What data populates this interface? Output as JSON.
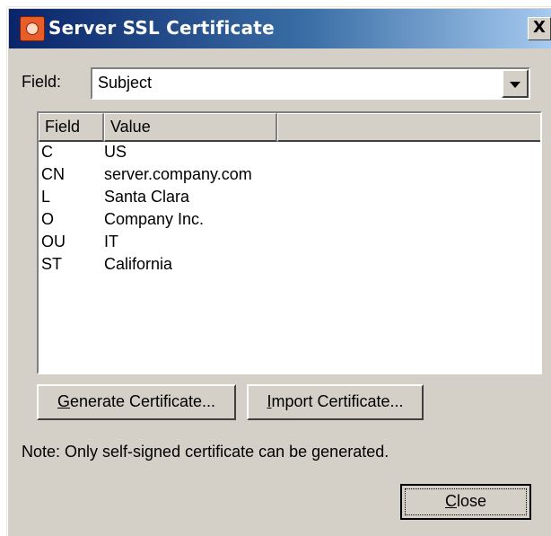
{
  "window": {
    "title": "Server SSL Certificate",
    "close_glyph": "X"
  },
  "field_selector": {
    "label": "Field:",
    "selected": "Subject"
  },
  "table": {
    "columns": [
      "Field",
      "Value",
      ""
    ],
    "rows": [
      {
        "field": "C",
        "value": "US"
      },
      {
        "field": "CN",
        "value": "server.company.com"
      },
      {
        "field": "L",
        "value": "Santa Clara"
      },
      {
        "field": "O",
        "value": "Company Inc."
      },
      {
        "field": "OU",
        "value": "IT"
      },
      {
        "field": "ST",
        "value": "California"
      }
    ]
  },
  "buttons": {
    "generate": {
      "mnemonic": "G",
      "rest": "enerate Certificate..."
    },
    "import": {
      "mnemonic": "I",
      "rest": "mport Certificate..."
    },
    "close": {
      "mnemonic": "C",
      "rest": "lose"
    }
  },
  "note": "Note: Only self-signed certificate can be generated.",
  "icons": {
    "app": "certificate-app-icon",
    "dropdown": "chevron-down-icon",
    "close": "close-icon"
  }
}
